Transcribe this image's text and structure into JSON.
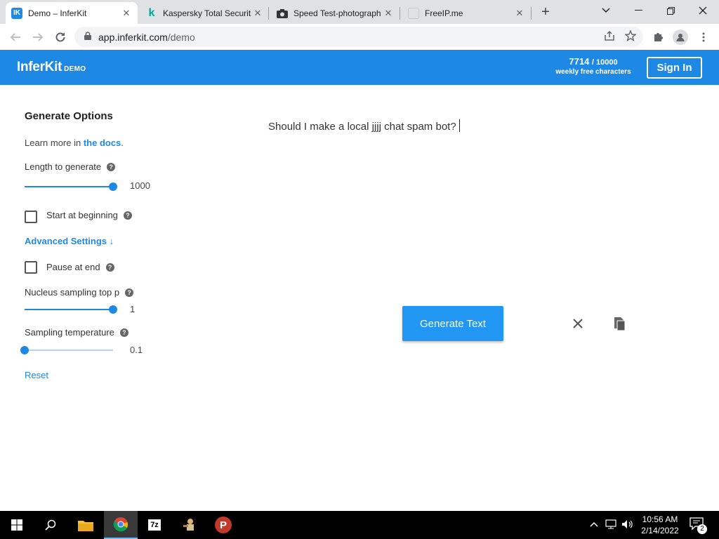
{
  "browser": {
    "tabs": [
      {
        "title": "Demo – InferKit",
        "favicon": "IK",
        "favicon_color": "#1e88e5",
        "active": true
      },
      {
        "title": "Kaspersky Total Securit",
        "favicon": "k",
        "favicon_color": "#ffffff",
        "active": false
      },
      {
        "title": "Speed Test-photograph",
        "favicon": "camera",
        "favicon_color": "#333333",
        "active": false
      },
      {
        "title": "FreeIP.me",
        "favicon": "blank",
        "favicon_color": "#dfe1e5",
        "active": false
      }
    ],
    "new_tab_label": "+",
    "url_domain": "app.inferkit.com",
    "url_path": "/demo"
  },
  "header": {
    "logo": "InferKit",
    "logo_tag": "DEMO",
    "quota_used": "7714",
    "quota_max": "/ 10000",
    "quota_label": "weekly free characters",
    "signin_label": "Sign In",
    "bg_color": "#1e88e5"
  },
  "sidebar": {
    "title": "Generate Options",
    "learn_prefix": "Learn more in ",
    "learn_link": "the docs",
    "learn_suffix": ".",
    "length_label": "Length to generate",
    "length_value": "1000",
    "length_fraction": 1.0,
    "start_label": "Start at beginning",
    "start_checked": false,
    "advanced_label": "Advanced Settings ↓",
    "pause_label": "Pause at end",
    "pause_checked": false,
    "nucleus_label": "Nucleus sampling top p",
    "nucleus_value": "1",
    "nucleus_fraction": 1.0,
    "temp_label": "Sampling temperature",
    "temp_value": "0.1",
    "temp_fraction": 0.0,
    "reset_label": "Reset"
  },
  "editor": {
    "text_before": "Should I make a local ",
    "text_misspelled": "jjjj",
    "text_after": " chat spam bot?",
    "generate_label": "Generate Text"
  },
  "taskbar": {
    "time": "10:56 AM",
    "date": "2/14/2022",
    "notification_count": "2"
  }
}
